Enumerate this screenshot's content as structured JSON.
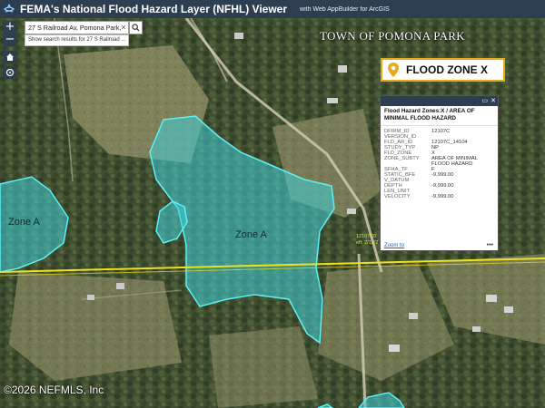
{
  "header": {
    "title": "FEMA's National Flood Hazard Layer (NFHL) Viewer",
    "subtitle": "with Web AppBuilder for ArcGIS"
  },
  "controls": {
    "zoom_in": "+",
    "zoom_out": "−",
    "home_icon": "home-icon",
    "locate_icon": "locate-icon"
  },
  "search": {
    "value": "27 S Railroad Av, Pomona Park,",
    "clear": "×",
    "hint": "Show search results for 27 S Railroad ..."
  },
  "map": {
    "town_label": "TOWN OF POMONA PARK",
    "zone_a_left": "Zone A",
    "zone_a_center": "Zone A",
    "tag_line1": "12107C0",
    "tag_line2": "eff. 2/12/2"
  },
  "flood_zone_badge": {
    "label": "FLOOD ZONE X"
  },
  "popup": {
    "title": "Flood Hazard Zones:X / AREA OF MINIMAL FLOOD HAZARD",
    "fields": [
      {
        "key": "DFIRM_ID",
        "value": "12107C"
      },
      {
        "key": "VERSION_ID",
        "value": ""
      },
      {
        "key": "FLD_AR_ID",
        "value": "12107C_14104"
      },
      {
        "key": "STUDY_TYP",
        "value": "NP"
      },
      {
        "key": "FLD_ZONE",
        "value": "X"
      },
      {
        "key": "ZONE_SUBTY",
        "value": "AREA OF MINIMAL FLOOD HAZARD"
      },
      {
        "key": "SFHA_TF",
        "value": "F"
      },
      {
        "key": "STATIC_BFE",
        "value": "-9,999.00"
      },
      {
        "key": "V_DATUM",
        "value": ""
      },
      {
        "key": "DEPTH",
        "value": "-9,999.00"
      },
      {
        "key": "LEN_UNIT",
        "value": ""
      },
      {
        "key": "VELOCITY",
        "value": "-9,999.00"
      }
    ],
    "zoom_link": "Zoom to",
    "more": "•••"
  },
  "copyright": "©2026 NEFMLS, Inc",
  "colors": {
    "header_bg": "#2d3e50",
    "flood_fill": "#3fd0d8",
    "badge_border": "#e8a91c",
    "boundary_line": "#f0e020"
  }
}
